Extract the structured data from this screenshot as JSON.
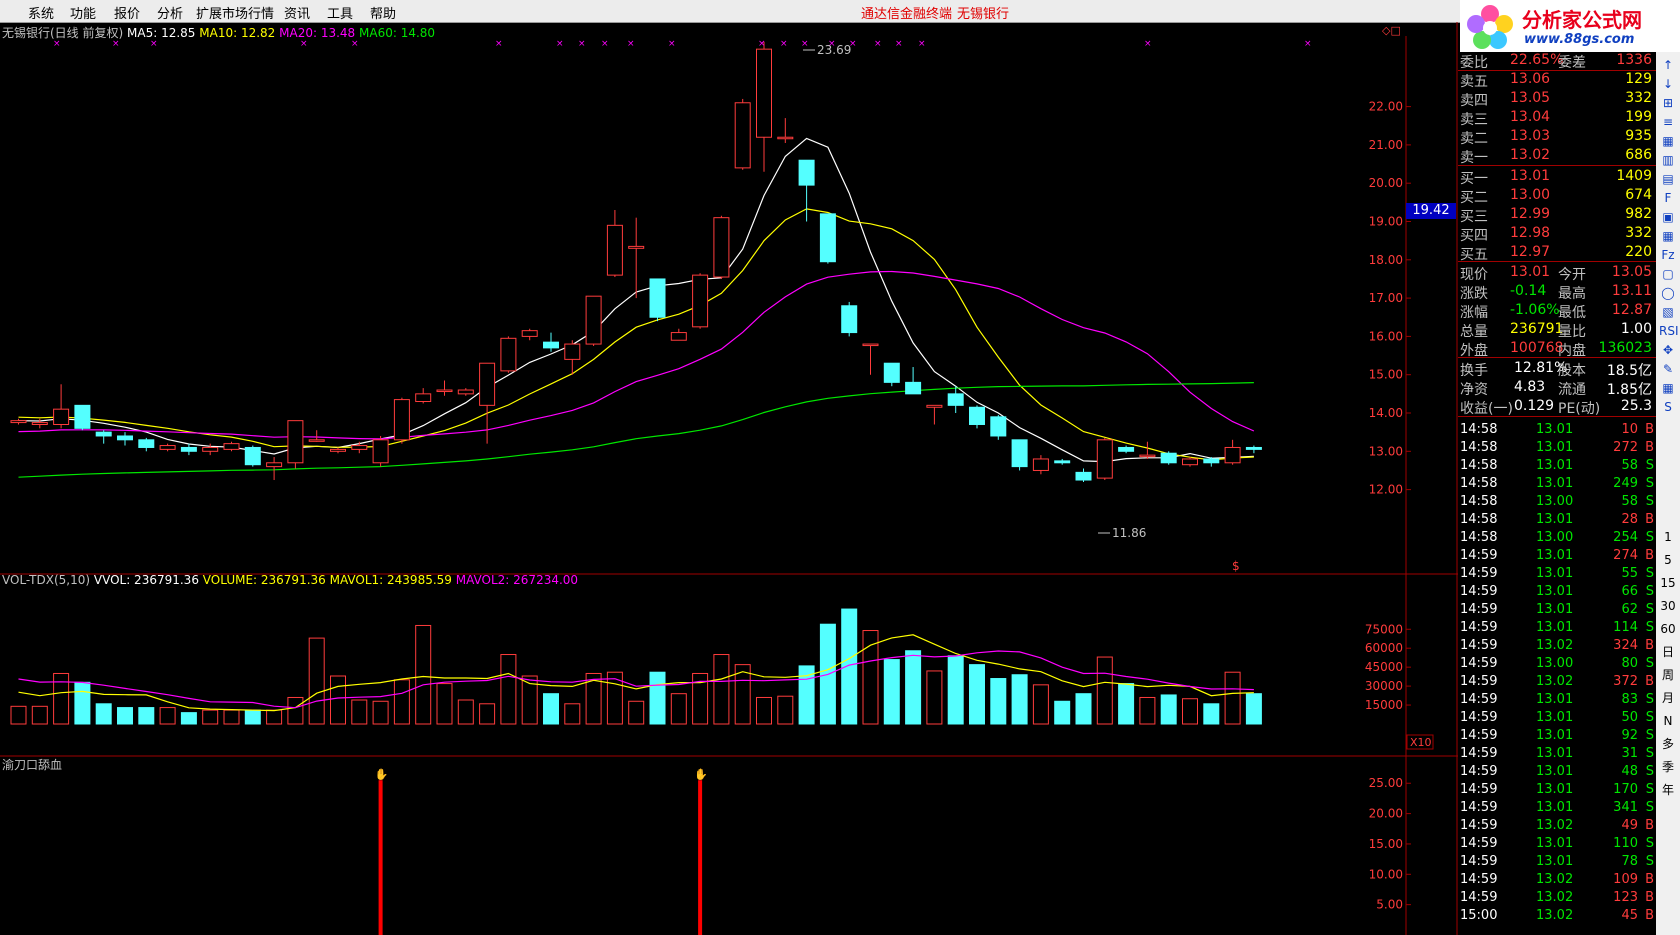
{
  "menu": {
    "items": [
      "系统",
      "功能",
      "报价",
      "分析",
      "扩展市场行情",
      "资讯",
      "工具",
      "帮助"
    ],
    "center_title": "通达信金融终端",
    "center_stock": "无锡银行",
    "right_label": "行"
  },
  "logo": {
    "title": "分析家公式网",
    "url": "www.88gs.com"
  },
  "main_header": {
    "name": "无锡银行(日线 前复权)",
    "ma5": "MA5: 12.85",
    "ma10": "MA10: 12.82",
    "ma20": "MA20: 13.48",
    "ma60": "MA60: 14.80"
  },
  "vol_header": {
    "name": "VOL-TDX(5,10)",
    "vvol": "VVOL: 236791.36",
    "volume": "VOLUME: 236791.36",
    "mavol1": "MAVOL1: 243985.59",
    "mavol2": "MAVOL2: 267234.00"
  },
  "ind_header": {
    "name": "渝刀口舔血"
  },
  "price_axis": [
    "22.00",
    "21.00",
    "20.00",
    "19.00",
    "18.00",
    "17.00",
    "16.00",
    "15.00",
    "14.00",
    "13.00",
    "12.00"
  ],
  "vol_axis": [
    "75000",
    "60000",
    "45000",
    "30000",
    "15000"
  ],
  "vol_unit": "X10",
  "ind_axis": [
    "25.00",
    "20.00",
    "15.00",
    "10.00",
    "5.00"
  ],
  "annotations": {
    "high": "23.69",
    "low": "11.86",
    "cursor_price": "19.42",
    "marker": "$"
  },
  "colors": {
    "up": "#ff3c3c",
    "down": "#54ffff",
    "ma5": "#ffffff",
    "ma10": "#ffff00",
    "ma20": "#ff00ff",
    "ma60": "#00e600",
    "signal": "#ff0000"
  },
  "quote": {
    "ratio": {
      "label": "委比",
      "value": "22.65%",
      "label2": "委差",
      "value2": "1336"
    },
    "asks": [
      {
        "label": "卖五",
        "price": "13.06",
        "vol": "129"
      },
      {
        "label": "卖四",
        "price": "13.05",
        "vol": "332"
      },
      {
        "label": "卖三",
        "price": "13.04",
        "vol": "199"
      },
      {
        "label": "卖二",
        "price": "13.03",
        "vol": "935"
      },
      {
        "label": "卖一",
        "price": "13.02",
        "vol": "686"
      }
    ],
    "bids": [
      {
        "label": "买一",
        "price": "13.01",
        "vol": "1409"
      },
      {
        "label": "买二",
        "price": "13.00",
        "vol": "674"
      },
      {
        "label": "买三",
        "price": "12.99",
        "vol": "982"
      },
      {
        "label": "买四",
        "price": "12.98",
        "vol": "332"
      },
      {
        "label": "买五",
        "price": "12.97",
        "vol": "220"
      }
    ],
    "stats": [
      {
        "l1": "现价",
        "v1": "13.01",
        "l2": "今开",
        "v2": "13.05"
      },
      {
        "l1": "涨跌",
        "v1": "-0.14",
        "l2": "最高",
        "v2": "13.11"
      },
      {
        "l1": "涨幅",
        "v1": "-1.06%",
        "l2": "最低",
        "v2": "12.87"
      },
      {
        "l1": "总量",
        "v1": "236791",
        "l2": "量比",
        "v2": "1.00"
      },
      {
        "l1": "外盘",
        "v1": "100768",
        "l2": "内盘",
        "v2": "136023"
      }
    ],
    "fund": [
      {
        "l1": "换手",
        "v1": "12.81%",
        "l2": "股本",
        "v2": "18.5亿"
      },
      {
        "l1": "净资",
        "v1": "4.83",
        "l2": "流通",
        "v2": "1.85亿"
      },
      {
        "l1": "收益(一)",
        "v1": "0.129",
        "l2": "PE(动)",
        "v2": "25.3"
      }
    ]
  },
  "ticks": [
    {
      "t": "14:58",
      "p": "13.01",
      "v": "10",
      "s": "B"
    },
    {
      "t": "14:58",
      "p": "13.01",
      "v": "272",
      "s": "B"
    },
    {
      "t": "14:58",
      "p": "13.01",
      "v": "58",
      "s": "S"
    },
    {
      "t": "14:58",
      "p": "13.01",
      "v": "249",
      "s": "S"
    },
    {
      "t": "14:58",
      "p": "13.00",
      "v": "58",
      "s": "S"
    },
    {
      "t": "14:58",
      "p": "13.01",
      "v": "28",
      "s": "B"
    },
    {
      "t": "14:58",
      "p": "13.00",
      "v": "254",
      "s": "S"
    },
    {
      "t": "14:59",
      "p": "13.01",
      "v": "274",
      "s": "B"
    },
    {
      "t": "14:59",
      "p": "13.01",
      "v": "55",
      "s": "S"
    },
    {
      "t": "14:59",
      "p": "13.01",
      "v": "66",
      "s": "S"
    },
    {
      "t": "14:59",
      "p": "13.01",
      "v": "62",
      "s": "S"
    },
    {
      "t": "14:59",
      "p": "13.01",
      "v": "114",
      "s": "S"
    },
    {
      "t": "14:59",
      "p": "13.02",
      "v": "324",
      "s": "B"
    },
    {
      "t": "14:59",
      "p": "13.00",
      "v": "80",
      "s": "S"
    },
    {
      "t": "14:59",
      "p": "13.02",
      "v": "372",
      "s": "B"
    },
    {
      "t": "14:59",
      "p": "13.01",
      "v": "83",
      "s": "S"
    },
    {
      "t": "14:59",
      "p": "13.01",
      "v": "50",
      "s": "S"
    },
    {
      "t": "14:59",
      "p": "13.01",
      "v": "92",
      "s": "S"
    },
    {
      "t": "14:59",
      "p": "13.01",
      "v": "31",
      "s": "S"
    },
    {
      "t": "14:59",
      "p": "13.01",
      "v": "48",
      "s": "S"
    },
    {
      "t": "14:59",
      "p": "13.01",
      "v": "170",
      "s": "S"
    },
    {
      "t": "14:59",
      "p": "13.01",
      "v": "341",
      "s": "S"
    },
    {
      "t": "14:59",
      "p": "13.02",
      "v": "49",
      "s": "B"
    },
    {
      "t": "14:59",
      "p": "13.01",
      "v": "110",
      "s": "S"
    },
    {
      "t": "14:59",
      "p": "13.01",
      "v": "78",
      "s": "S"
    },
    {
      "t": "14:59",
      "p": "13.02",
      "v": "109",
      "s": "B"
    },
    {
      "t": "14:59",
      "p": "13.02",
      "v": "123",
      "s": "B"
    },
    {
      "t": "15:00",
      "p": "13.02",
      "v": "45",
      "s": "B"
    }
  ],
  "toolbar": [
    "1",
    "5",
    "15",
    "30",
    "60",
    "日",
    "周",
    "月",
    "N",
    "多",
    "季",
    "年"
  ],
  "candles": [
    [
      13.75,
      13.8,
      13.7,
      13.85
    ],
    [
      13.7,
      13.75,
      13.6,
      13.85
    ],
    [
      13.7,
      14.1,
      13.6,
      14.75
    ],
    [
      14.2,
      13.6,
      13.55,
      14.2
    ],
    [
      13.5,
      13.4,
      13.2,
      13.55
    ],
    [
      13.4,
      13.3,
      13.15,
      13.5
    ],
    [
      13.3,
      13.1,
      13.0,
      13.35
    ],
    [
      13.05,
      13.15,
      13.0,
      13.2
    ],
    [
      13.1,
      13.0,
      12.9,
      13.2
    ],
    [
      13.0,
      13.1,
      12.9,
      13.2
    ],
    [
      13.05,
      13.2,
      13.0,
      13.25
    ],
    [
      13.1,
      12.65,
      12.6,
      13.15
    ],
    [
      12.6,
      12.7,
      12.25,
      12.85
    ],
    [
      12.7,
      13.8,
      12.55,
      13.8
    ],
    [
      13.3,
      13.3,
      13.25,
      13.55
    ],
    [
      13.0,
      13.05,
      12.95,
      13.1
    ],
    [
      13.05,
      13.15,
      12.95,
      13.25
    ],
    [
      12.7,
      13.3,
      12.6,
      13.4
    ],
    [
      13.3,
      14.35,
      13.2,
      14.4
    ],
    [
      14.3,
      14.5,
      14.25,
      14.65
    ],
    [
      14.6,
      14.6,
      14.45,
      14.85
    ],
    [
      14.5,
      14.6,
      14.45,
      14.65
    ],
    [
      14.2,
      15.3,
      13.2,
      15.3
    ],
    [
      15.1,
      15.95,
      15.05,
      16.0
    ],
    [
      16.0,
      16.15,
      15.9,
      16.2
    ],
    [
      15.85,
      15.7,
      15.6,
      16.1
    ],
    [
      15.4,
      15.8,
      15.0,
      15.9
    ],
    [
      15.8,
      17.05,
      15.75,
      17.05
    ],
    [
      17.6,
      18.9,
      17.55,
      19.3
    ],
    [
      18.3,
      18.35,
      17.0,
      19.1
    ],
    [
      17.5,
      16.5,
      16.4,
      17.5
    ],
    [
      15.9,
      16.1,
      15.9,
      16.2
    ],
    [
      16.25,
      17.6,
      16.2,
      17.65
    ],
    [
      17.55,
      19.1,
      17.5,
      19.15
    ],
    [
      20.4,
      22.1,
      20.35,
      22.2
    ],
    [
      21.2,
      23.5,
      20.3,
      23.69
    ],
    [
      21.2,
      21.2,
      21.05,
      21.7
    ],
    [
      20.6,
      19.95,
      19.0,
      20.6
    ],
    [
      19.2,
      17.95,
      17.9,
      19.2
    ],
    [
      16.8,
      16.1,
      16.0,
      16.9
    ],
    [
      15.8,
      15.8,
      15.0,
      15.8
    ],
    [
      15.3,
      14.8,
      14.7,
      15.3
    ],
    [
      14.8,
      14.5,
      14.5,
      15.2
    ],
    [
      14.15,
      14.2,
      13.7,
      14.2
    ],
    [
      14.5,
      14.2,
      14.0,
      14.7
    ],
    [
      14.15,
      13.7,
      13.6,
      14.2
    ],
    [
      13.9,
      13.4,
      13.3,
      13.95
    ],
    [
      13.3,
      12.6,
      12.5,
      13.3
    ],
    [
      12.5,
      12.8,
      12.4,
      12.9
    ],
    [
      12.75,
      12.7,
      12.65,
      12.8
    ],
    [
      12.45,
      12.25,
      12.2,
      12.55
    ],
    [
      12.3,
      13.3,
      12.25,
      13.35
    ],
    [
      13.1,
      13.0,
      12.95,
      13.15
    ],
    [
      12.9,
      12.9,
      12.8,
      13.25
    ],
    [
      12.95,
      12.7,
      12.65,
      13.0
    ],
    [
      12.65,
      12.8,
      12.6,
      12.85
    ],
    [
      12.8,
      12.7,
      12.6,
      12.85
    ],
    [
      12.7,
      13.1,
      12.65,
      13.3
    ],
    [
      13.1,
      13.05,
      12.95,
      13.15
    ]
  ],
  "volumes": [
    14000,
    14000,
    40000,
    33000,
    16000,
    13000,
    13000,
    13000,
    9000,
    11000,
    11000,
    11000,
    11000,
    21000,
    68000,
    38000,
    19000,
    18000,
    35000,
    78000,
    32000,
    19000,
    16000,
    55000,
    38000,
    24000,
    16000,
    40000,
    41000,
    18000,
    41000,
    24000,
    40000,
    55000,
    47000,
    21000,
    22000,
    46000,
    79000,
    91000,
    74000,
    51000,
    58000,
    42000,
    54000,
    47000,
    36000,
    39000,
    31000,
    18000,
    24000,
    53000,
    32000,
    21000,
    23000,
    20000,
    16000,
    41000,
    24000
  ],
  "signals": [
    17,
    32
  ],
  "signal_value": 25.5,
  "ranges": {
    "price": [
      11.2,
      24.0
    ],
    "vol": [
      0,
      95000
    ],
    "ind": [
      0,
      28.5
    ]
  }
}
